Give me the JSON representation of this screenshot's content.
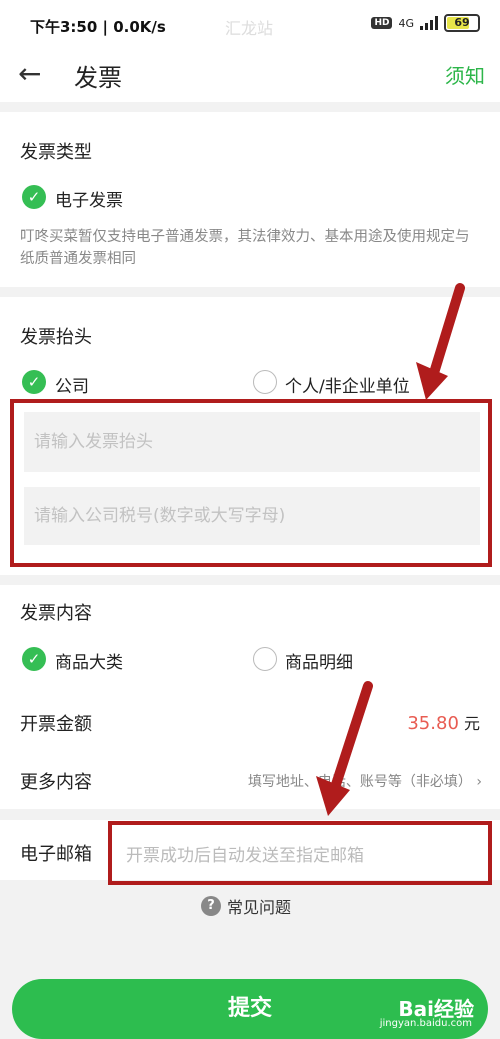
{
  "status_bar": {
    "time_speed": "下午3:50 | 0.0K/s",
    "watermark": "汇龙站",
    "hd": "HD",
    "network": "4G",
    "battery": "69"
  },
  "header": {
    "title": "发票",
    "notice": "须知"
  },
  "invoice_type": {
    "title": "发票类型",
    "option": "电子发票",
    "note": "叮咚买菜暂仅支持电子普通发票，其法律效力、基本用途及使用规定与纸质普通发票相同"
  },
  "invoice_header": {
    "title": "发票抬头",
    "options": [
      "公司",
      "个人/非企业单位"
    ],
    "title_placeholder": "请输入发票抬头",
    "tax_placeholder": "请输入公司税号(数字或大写字母)"
  },
  "invoice_content": {
    "title": "发票内容",
    "options": [
      "商品大类",
      "商品明细"
    ],
    "amount_label": "开票金额",
    "amount_value": "35.80",
    "amount_unit": "元",
    "more_label": "更多内容",
    "more_value": "填写地址、电话、账号等（非必填）"
  },
  "email": {
    "label": "电子邮箱",
    "placeholder": "开票成功后自动发送至指定邮箱"
  },
  "faq": {
    "label": "常见问题"
  },
  "submit": {
    "label": "提交"
  },
  "watermark": {
    "logo": "Bai经验",
    "url": "jingyan.baidu.com"
  },
  "colors": {
    "accent": "#35be54",
    "amount": "#e85c52",
    "annotation": "#b01c1c"
  }
}
